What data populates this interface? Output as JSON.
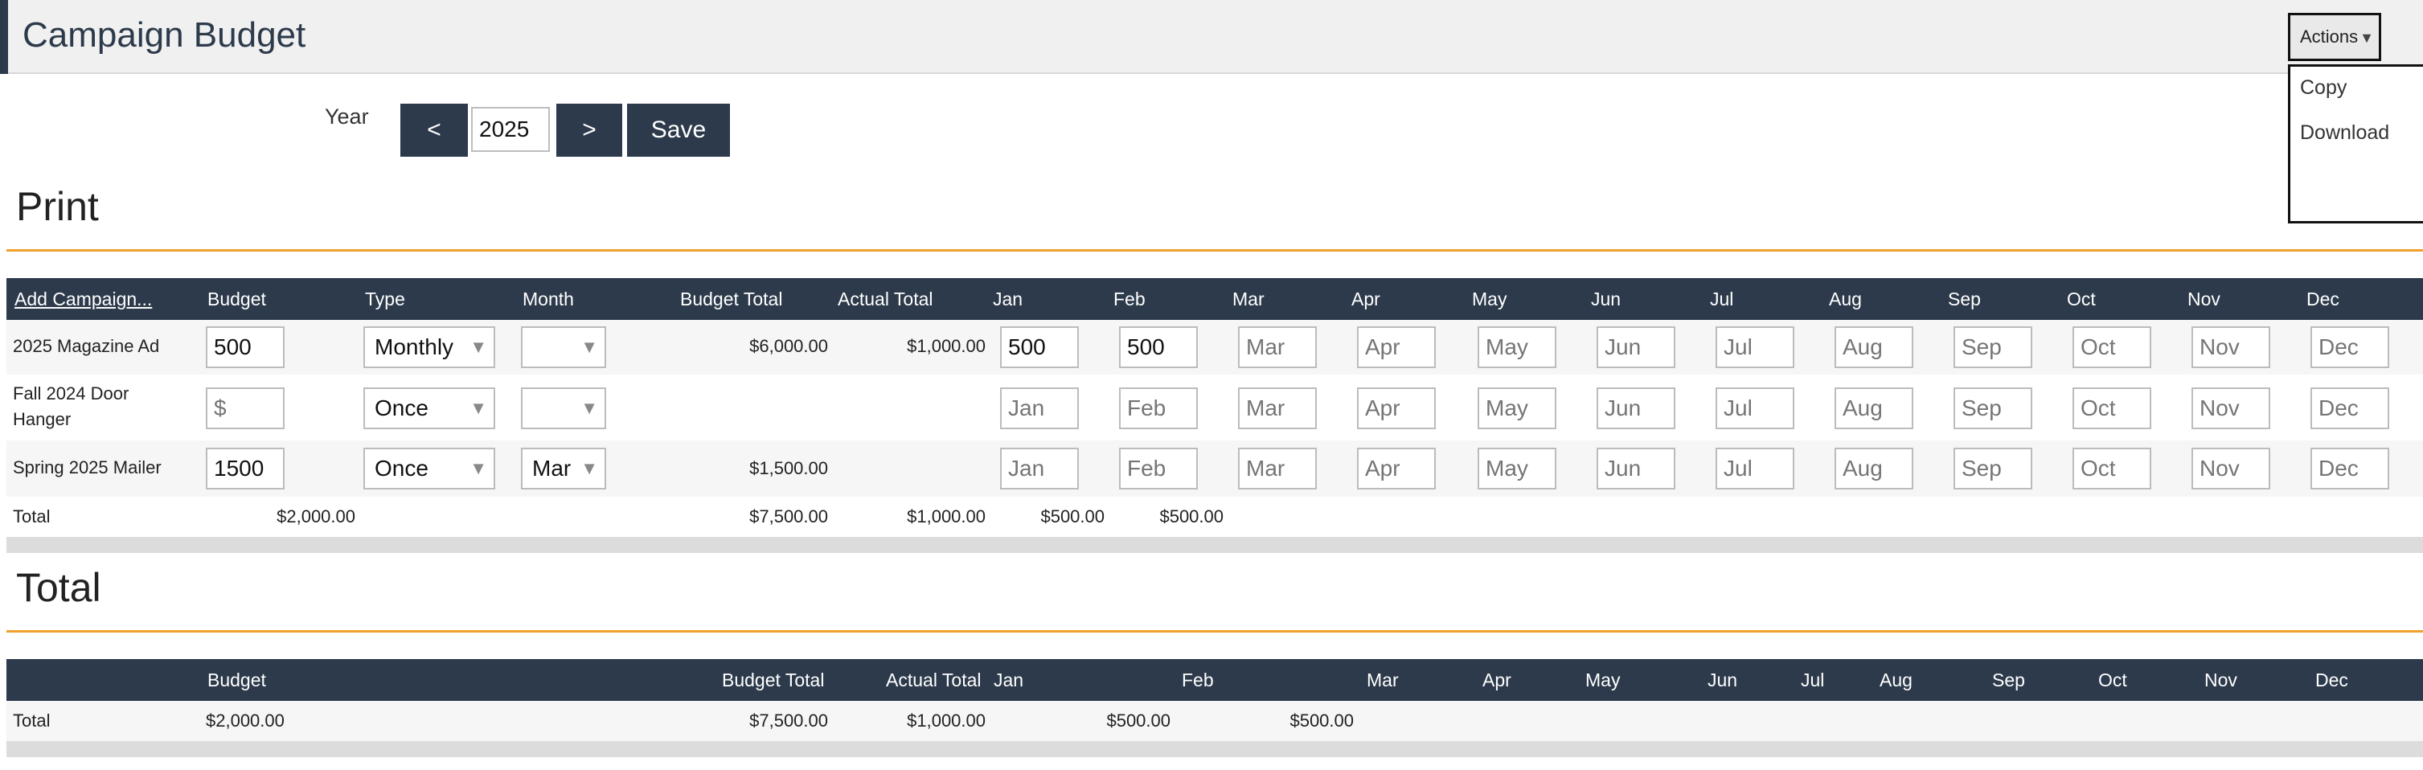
{
  "page": {
    "title": "Campaign Budget"
  },
  "actions": {
    "label": "Actions",
    "caret": "▼",
    "menu": [
      "Copy",
      "Download"
    ]
  },
  "year_nav": {
    "label": "Year",
    "prev": "<",
    "value": "2025",
    "next": ">",
    "save": "Save"
  },
  "print": {
    "title": "Print",
    "headers": [
      "Add Campaign...",
      "Budget",
      "Type",
      "Month",
      "Budget Total",
      "Actual Total",
      "Jan",
      "Feb",
      "Mar",
      "Apr",
      "May",
      "Jun",
      "Jul",
      "Aug",
      "Sep",
      "Oct",
      "Nov",
      "Dec"
    ],
    "rows": [
      {
        "name": "2025 Magazine Ad",
        "budget": "500",
        "budget_placeholder": "$",
        "type": "Monthly",
        "month": "",
        "budget_total": "$6,000.00",
        "actual_total": "$1,000.00",
        "months": [
          "500",
          "500",
          "",
          "",
          "",
          "",
          "",
          "",
          "",
          "",
          "",
          ""
        ]
      },
      {
        "name": "Fall 2024 Door Hanger",
        "budget": "",
        "budget_placeholder": "$",
        "type": "Once",
        "month": "",
        "budget_total": "",
        "actual_total": "",
        "months": [
          "",
          "",
          "",
          "",
          "",
          "",
          "",
          "",
          "",
          "",
          "",
          ""
        ]
      },
      {
        "name": "Spring 2025 Mailer",
        "budget": "1500",
        "budget_placeholder": "$",
        "type": "Once",
        "month": "Mar",
        "budget_total": "$1,500.00",
        "actual_total": "",
        "months": [
          "",
          "",
          "",
          "",
          "",
          "",
          "",
          "",
          "",
          "",
          "",
          ""
        ]
      }
    ],
    "month_placeholders": [
      "Jan",
      "Feb",
      "Mar",
      "Apr",
      "May",
      "Jun",
      "Jul",
      "Aug",
      "Sep",
      "Oct",
      "Nov",
      "Dec"
    ],
    "total": {
      "label": "Total",
      "budget": "$2,000.00",
      "budget_total": "$7,500.00",
      "actual_total": "$1,000.00",
      "jan": "$500.00",
      "feb": "$500.00"
    }
  },
  "total_section": {
    "title": "Total",
    "headers": [
      "Budget",
      "Budget Total",
      "Actual Total",
      "Jan",
      "Feb",
      "Mar",
      "Apr",
      "May",
      "Jun",
      "Jul",
      "Aug",
      "Sep",
      "Oct",
      "Nov",
      "Dec"
    ],
    "row": {
      "label": "Total",
      "budget": "$2,000.00",
      "budget_total": "$7,500.00",
      "actual_total": "$1,000.00",
      "jan": "$500.00",
      "feb": "$500.00"
    }
  },
  "colors": {
    "header_bg": "#2c3a4b",
    "accent_rule": "#f0a02c",
    "stripe": "#f6f6f6"
  }
}
